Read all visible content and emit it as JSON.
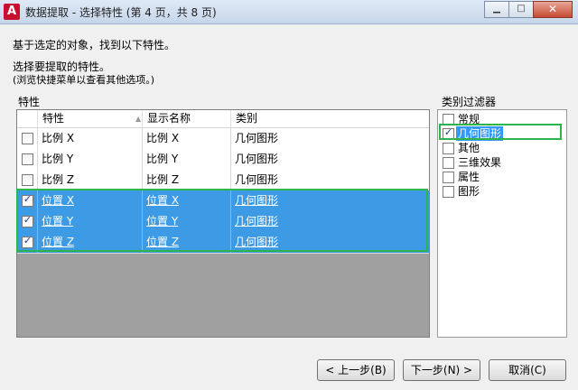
{
  "window": {
    "title": "数据提取 - 选择特性 (第 4 页，共 8 页)",
    "app_icon_glyph": "A",
    "minimize_glyph": "▁",
    "maximize_glyph": "□",
    "close_glyph": "✕"
  },
  "instructions": {
    "line1": "基于选定的对象，找到以下特性。",
    "line2": "选择要提取的特性。",
    "line3": "(浏览快捷菜单以查看其他选项。)"
  },
  "properties_section": {
    "label": "特性",
    "columns": [
      "特性",
      "显示名称",
      "类别"
    ],
    "sort_indicator": "▲",
    "rows": [
      {
        "checked": false,
        "property": "比例 X",
        "display": "比例 X",
        "category": "几何图形",
        "selected": false
      },
      {
        "checked": false,
        "property": "比例 Y",
        "display": "比例 Y",
        "category": "几何图形",
        "selected": false
      },
      {
        "checked": false,
        "property": "比例 Z",
        "display": "比例 Z",
        "category": "几何图形",
        "selected": false
      },
      {
        "checked": true,
        "property": "位置 X",
        "display": "位置 X",
        "category": "几何图形",
        "selected": true
      },
      {
        "checked": true,
        "property": "位置 Y",
        "display": "位置 Y",
        "category": "几何图形",
        "selected": true
      },
      {
        "checked": true,
        "property": "位置 Z",
        "display": "位置 Z",
        "category": "几何图形",
        "selected": true
      }
    ],
    "check_glyph": "✓"
  },
  "category_filter": {
    "label": "类别过滤器",
    "items": [
      {
        "label": "常规",
        "checked": false,
        "selected": false
      },
      {
        "label": "几何图形",
        "checked": true,
        "selected": true
      },
      {
        "label": "其他",
        "checked": false,
        "selected": false
      },
      {
        "label": "三维效果",
        "checked": false,
        "selected": false
      },
      {
        "label": "属性",
        "checked": false,
        "selected": false
      },
      {
        "label": "图形",
        "checked": false,
        "selected": false
      }
    ]
  },
  "buttons": {
    "back": "< 上一步(B)",
    "next": "下一步(N) >",
    "cancel": "取消(C)"
  },
  "colors": {
    "selection": "#3d9be6",
    "highlight_outline": "#2fb34b"
  }
}
